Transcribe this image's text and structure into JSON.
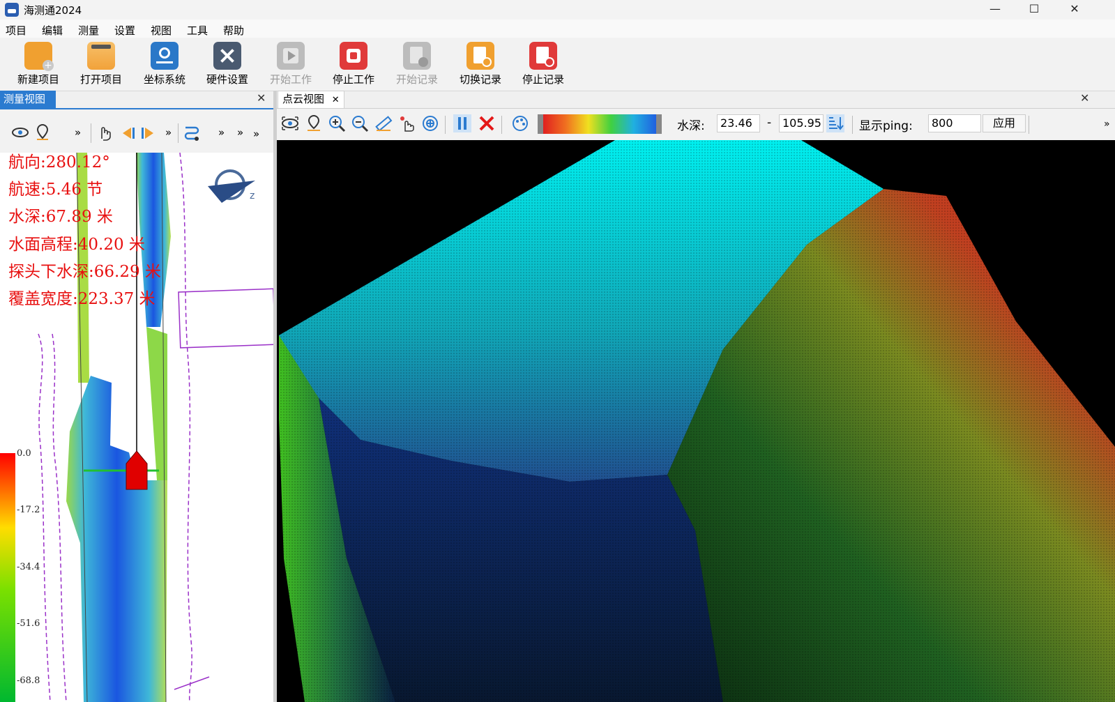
{
  "window": {
    "title": "海测通2024",
    "minimize": "—",
    "maximize": "☐",
    "close": "✕"
  },
  "menu": [
    "项目",
    "编辑",
    "测量",
    "设置",
    "视图",
    "工具",
    "帮助"
  ],
  "toolbar": [
    {
      "label": "新建项目",
      "icon": "new-project-icon",
      "color": "#f0a030",
      "disabled": false
    },
    {
      "label": "打开项目",
      "icon": "open-folder-icon",
      "color": "#f2a23a",
      "disabled": false
    },
    {
      "label": "坐标系统",
      "icon": "coordinate-system-icon",
      "color": "#2a78c8",
      "disabled": false
    },
    {
      "label": "硬件设置",
      "icon": "hardware-settings-icon",
      "color": "#4a5a70",
      "disabled": false
    },
    {
      "label": "开始工作",
      "icon": "start-work-icon",
      "color": "#b8b8b8",
      "disabled": true
    },
    {
      "label": "停止工作",
      "icon": "stop-work-icon",
      "color": "#e03a3a",
      "disabled": false
    },
    {
      "label": "开始记录",
      "icon": "start-record-icon",
      "color": "#b8b8b8",
      "disabled": true
    },
    {
      "label": "切换记录",
      "icon": "switch-record-icon",
      "color": "#f0a030",
      "disabled": false
    },
    {
      "label": "停止记录",
      "icon": "stop-record-icon",
      "color": "#e03a3a",
      "disabled": false
    }
  ],
  "left_panel": {
    "tab": "测量视图",
    "close": "✕",
    "overflow": "»",
    "info": [
      "航向:280.12°",
      "航速:5.46 节",
      "水深:67.89 米",
      "水面高程:40.20 米",
      "探头下水深:66.29 米",
      "覆盖宽度:223.37 米"
    ],
    "depth_legend": [
      "0.0",
      "-17.2",
      "-34.4",
      "-51.6",
      "-68.8"
    ]
  },
  "right_panel": {
    "tab": "点云视图",
    "close": "✕",
    "depth_label": "水深:",
    "depth_min": "23.46",
    "dash": "-",
    "depth_max": "105.95",
    "ping_label": "显示ping:",
    "ping_value": "800",
    "apply": "应用",
    "overflow": "»"
  },
  "colors": {
    "accent": "#2b7bd0",
    "info_text": "#e81010"
  }
}
